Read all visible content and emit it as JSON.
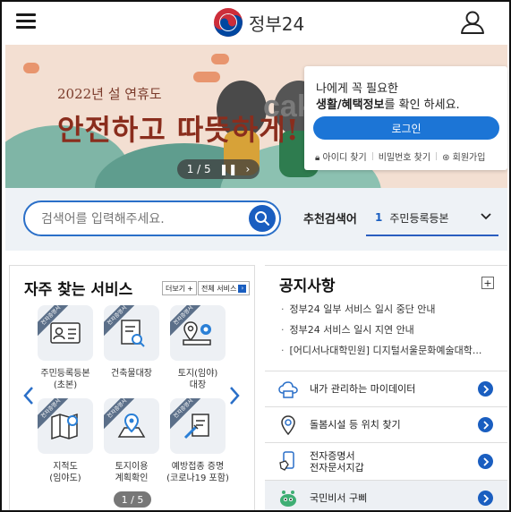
{
  "header": {
    "logo_text": "정부24",
    "menu_icon": "hamburger-menu-icon",
    "user_icon": "user-profile-icon"
  },
  "banner": {
    "small_text": "2022년 설 연휴도",
    "big_text": "안전하고 따뜻하게!",
    "watermark": "cake",
    "pager_text": "1 / 5"
  },
  "login": {
    "line1": "나에게 꼭 필요한",
    "line2_bold": "생활/혜택정보",
    "line2_rest": "를 확인 하세요.",
    "button": "로그인",
    "find_id": "아이디 찾기",
    "find_pw": "비밀번호 찾기",
    "signup": "회원가입"
  },
  "search": {
    "placeholder": "검색어를 입력해주세요.",
    "rec_label": "추천검색어",
    "rec_num": "1",
    "rec_value": "주민등록등본"
  },
  "favorites": {
    "title": "자주 찾는 서비스",
    "more": "더보기",
    "all": "전체 서비스",
    "ribbon": "전자증명서",
    "items": [
      {
        "label": "주민등록등본\n(초본)"
      },
      {
        "label": "건축물대장"
      },
      {
        "label": "토지(임야)\n대장"
      },
      {
        "label": "지적도\n(임야도)"
      },
      {
        "label": "토지이용\n계획확인"
      },
      {
        "label": "예방접종 증명\n(코로나19 포함)"
      }
    ],
    "pager": "1 / 5"
  },
  "notice": {
    "title": "공지사항",
    "items": [
      "정부24 일부 서비스 일시 중단 안내",
      "정부24 서비스 일시 지연 안내",
      "[어디서나대학민원] 디지털서울문화예술대학..."
    ]
  },
  "quick": [
    {
      "label": "내가 관리하는 마이데이터",
      "icon": "cloud-data-icon"
    },
    {
      "label": "돌봄시설 등 위치 찾기",
      "icon": "location-pin-icon"
    },
    {
      "label1": "전자증명서",
      "label2": "전자문서지갑",
      "icon": "mobile-wallet-icon"
    },
    {
      "label": "국민비서 구삐",
      "icon": "assistant-robot-icon"
    }
  ],
  "colors": {
    "primary": "#1a5ec0",
    "login_button": "#1c75d6",
    "banner_bg": "#f3dfd2"
  }
}
